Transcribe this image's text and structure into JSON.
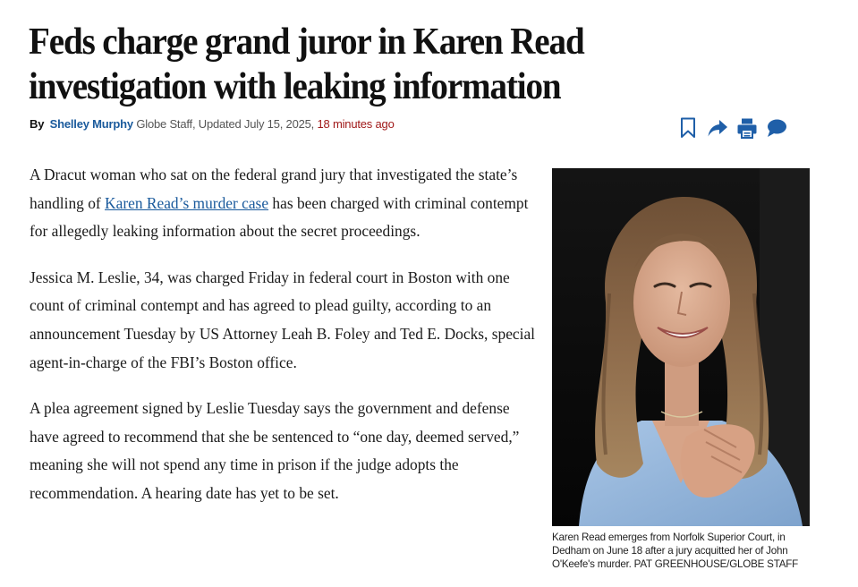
{
  "headline": "Feds charge grand juror in Karen Read investigation with leaking information",
  "byline": {
    "by": "By",
    "author": "Shelley Murphy",
    "meta": "Globe Staff, Updated July 15, 2025,",
    "time_ago": "18 minutes ago"
  },
  "tools": [
    "bookmark-icon",
    "share-icon",
    "print-icon",
    "comment-icon"
  ],
  "colors": {
    "link": "#1a5a9c",
    "tools": "#1f5fa8",
    "time": "#a01919"
  },
  "article": {
    "p1_before": "A Dracut woman who sat on the federal grand jury that investigated the state’s handling of ",
    "p1_link": "Karen Read’s murder case",
    "p1_after": " has been charged with criminal contempt for allegedly leaking information about the secret proceedings.",
    "p2": "Jessica M. Leslie, 34, was charged Friday in federal court in Boston with one count of criminal contempt and has agreed to plead guilty, according to an announcement Tuesday by US Attorney Leah B. Foley and Ted E. Docks, special agent-in-charge of the FBI’s Boston office.",
    "p3": "A plea agreement signed by Leslie Tuesday says the government and defense have agreed to recommend that she be sentenced to “one day, deemed served,” meaning she will not spend any time in prison if the judge adopts the recommendation. A hearing date has yet to be set."
  },
  "photo_caption": "Karen Read emerges from Norfolk Superior Court, in Dedham on June 18 after a jury acquitted her of John O'Keefe's murder.  PAT GREENHOUSE/GLOBE STAFF"
}
